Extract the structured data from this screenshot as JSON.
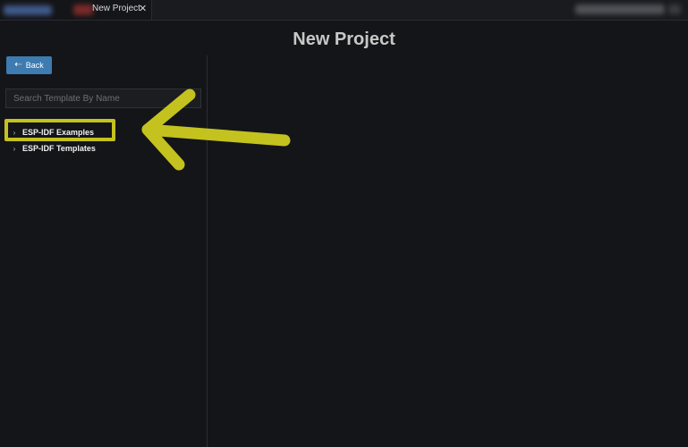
{
  "tab": {
    "title": "New Project",
    "close_glyph": "✕"
  },
  "page": {
    "title": "New Project"
  },
  "sidebar": {
    "back_label": "Back",
    "back_icon": "arrow-left-icon",
    "search": {
      "placeholder": "Search Template By Name",
      "value": ""
    },
    "tree": [
      {
        "label": "ESP-IDF Examples",
        "icon": "chevron-right-icon",
        "highlighted": true
      },
      {
        "label": "ESP-IDF Templates",
        "icon": "chevron-right-icon",
        "highlighted": false
      }
    ]
  },
  "colors": {
    "background": "#141518",
    "accent_button": "#3d7bb0",
    "annotation": "#c4c21e"
  }
}
